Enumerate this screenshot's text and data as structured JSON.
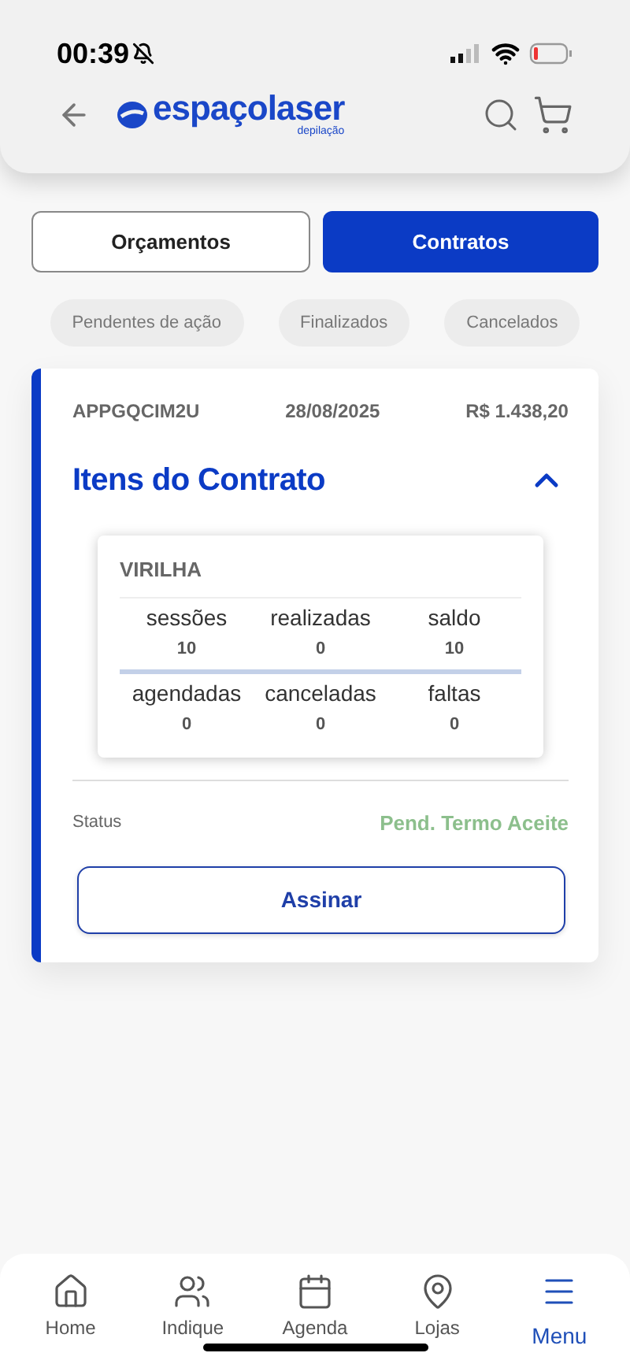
{
  "status_bar": {
    "time": "00:39"
  },
  "header": {
    "brand": "espaçolaser",
    "brand_subtitle": "depilação"
  },
  "tabs": [
    {
      "label": "Orçamentos",
      "selected": false
    },
    {
      "label": "Contratos",
      "selected": true
    }
  ],
  "filters": [
    {
      "label": "Pendentes de ação",
      "selected": false
    },
    {
      "label": "Finalizados",
      "selected": false
    },
    {
      "label": "Cancelados",
      "selected": false
    }
  ],
  "contract": {
    "code": "APPGQCIM2U",
    "date": "28/08/2025",
    "price": "R$ 1.438,20",
    "section_title": "Itens do Contrato",
    "expanded": true,
    "item": {
      "name": "VIRILHA",
      "rows": [
        [
          {
            "label": "sessões",
            "value": "10"
          },
          {
            "label": "realizadas",
            "value": "0"
          },
          {
            "label": "saldo",
            "value": "10"
          }
        ],
        [
          {
            "label": "agendadas",
            "value": "0"
          },
          {
            "label": "canceladas",
            "value": "0"
          },
          {
            "label": "faltas",
            "value": "0"
          }
        ]
      ]
    },
    "status_label": "Status",
    "status_value": "Pend. Termo Aceite",
    "action": "Assinar"
  },
  "nav": [
    {
      "label": "Home",
      "selected": false
    },
    {
      "label": "Indique",
      "selected": false
    },
    {
      "label": "Agenda",
      "selected": false
    },
    {
      "label": "Lojas",
      "selected": false
    },
    {
      "label": "Menu",
      "selected": true
    }
  ]
}
